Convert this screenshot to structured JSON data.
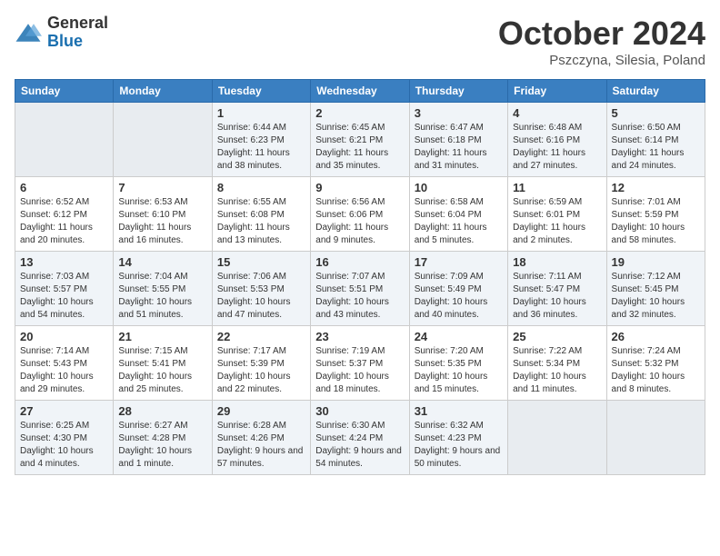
{
  "logo": {
    "general": "General",
    "blue": "Blue"
  },
  "title": "October 2024",
  "location": "Pszczyna, Silesia, Poland",
  "days_of_week": [
    "Sunday",
    "Monday",
    "Tuesday",
    "Wednesday",
    "Thursday",
    "Friday",
    "Saturday"
  ],
  "weeks": [
    [
      {
        "day": "",
        "sunrise": "",
        "sunset": "",
        "daylight": "",
        "empty": true
      },
      {
        "day": "",
        "sunrise": "",
        "sunset": "",
        "daylight": "",
        "empty": true
      },
      {
        "day": "1",
        "sunrise": "Sunrise: 6:44 AM",
        "sunset": "Sunset: 6:23 PM",
        "daylight": "Daylight: 11 hours and 38 minutes."
      },
      {
        "day": "2",
        "sunrise": "Sunrise: 6:45 AM",
        "sunset": "Sunset: 6:21 PM",
        "daylight": "Daylight: 11 hours and 35 minutes."
      },
      {
        "day": "3",
        "sunrise": "Sunrise: 6:47 AM",
        "sunset": "Sunset: 6:18 PM",
        "daylight": "Daylight: 11 hours and 31 minutes."
      },
      {
        "day": "4",
        "sunrise": "Sunrise: 6:48 AM",
        "sunset": "Sunset: 6:16 PM",
        "daylight": "Daylight: 11 hours and 27 minutes."
      },
      {
        "day": "5",
        "sunrise": "Sunrise: 6:50 AM",
        "sunset": "Sunset: 6:14 PM",
        "daylight": "Daylight: 11 hours and 24 minutes."
      }
    ],
    [
      {
        "day": "6",
        "sunrise": "Sunrise: 6:52 AM",
        "sunset": "Sunset: 6:12 PM",
        "daylight": "Daylight: 11 hours and 20 minutes."
      },
      {
        "day": "7",
        "sunrise": "Sunrise: 6:53 AM",
        "sunset": "Sunset: 6:10 PM",
        "daylight": "Daylight: 11 hours and 16 minutes."
      },
      {
        "day": "8",
        "sunrise": "Sunrise: 6:55 AM",
        "sunset": "Sunset: 6:08 PM",
        "daylight": "Daylight: 11 hours and 13 minutes."
      },
      {
        "day": "9",
        "sunrise": "Sunrise: 6:56 AM",
        "sunset": "Sunset: 6:06 PM",
        "daylight": "Daylight: 11 hours and 9 minutes."
      },
      {
        "day": "10",
        "sunrise": "Sunrise: 6:58 AM",
        "sunset": "Sunset: 6:04 PM",
        "daylight": "Daylight: 11 hours and 5 minutes."
      },
      {
        "day": "11",
        "sunrise": "Sunrise: 6:59 AM",
        "sunset": "Sunset: 6:01 PM",
        "daylight": "Daylight: 11 hours and 2 minutes."
      },
      {
        "day": "12",
        "sunrise": "Sunrise: 7:01 AM",
        "sunset": "Sunset: 5:59 PM",
        "daylight": "Daylight: 10 hours and 58 minutes."
      }
    ],
    [
      {
        "day": "13",
        "sunrise": "Sunrise: 7:03 AM",
        "sunset": "Sunset: 5:57 PM",
        "daylight": "Daylight: 10 hours and 54 minutes."
      },
      {
        "day": "14",
        "sunrise": "Sunrise: 7:04 AM",
        "sunset": "Sunset: 5:55 PM",
        "daylight": "Daylight: 10 hours and 51 minutes."
      },
      {
        "day": "15",
        "sunrise": "Sunrise: 7:06 AM",
        "sunset": "Sunset: 5:53 PM",
        "daylight": "Daylight: 10 hours and 47 minutes."
      },
      {
        "day": "16",
        "sunrise": "Sunrise: 7:07 AM",
        "sunset": "Sunset: 5:51 PM",
        "daylight": "Daylight: 10 hours and 43 minutes."
      },
      {
        "day": "17",
        "sunrise": "Sunrise: 7:09 AM",
        "sunset": "Sunset: 5:49 PM",
        "daylight": "Daylight: 10 hours and 40 minutes."
      },
      {
        "day": "18",
        "sunrise": "Sunrise: 7:11 AM",
        "sunset": "Sunset: 5:47 PM",
        "daylight": "Daylight: 10 hours and 36 minutes."
      },
      {
        "day": "19",
        "sunrise": "Sunrise: 7:12 AM",
        "sunset": "Sunset: 5:45 PM",
        "daylight": "Daylight: 10 hours and 32 minutes."
      }
    ],
    [
      {
        "day": "20",
        "sunrise": "Sunrise: 7:14 AM",
        "sunset": "Sunset: 5:43 PM",
        "daylight": "Daylight: 10 hours and 29 minutes."
      },
      {
        "day": "21",
        "sunrise": "Sunrise: 7:15 AM",
        "sunset": "Sunset: 5:41 PM",
        "daylight": "Daylight: 10 hours and 25 minutes."
      },
      {
        "day": "22",
        "sunrise": "Sunrise: 7:17 AM",
        "sunset": "Sunset: 5:39 PM",
        "daylight": "Daylight: 10 hours and 22 minutes."
      },
      {
        "day": "23",
        "sunrise": "Sunrise: 7:19 AM",
        "sunset": "Sunset: 5:37 PM",
        "daylight": "Daylight: 10 hours and 18 minutes."
      },
      {
        "day": "24",
        "sunrise": "Sunrise: 7:20 AM",
        "sunset": "Sunset: 5:35 PM",
        "daylight": "Daylight: 10 hours and 15 minutes."
      },
      {
        "day": "25",
        "sunrise": "Sunrise: 7:22 AM",
        "sunset": "Sunset: 5:34 PM",
        "daylight": "Daylight: 10 hours and 11 minutes."
      },
      {
        "day": "26",
        "sunrise": "Sunrise: 7:24 AM",
        "sunset": "Sunset: 5:32 PM",
        "daylight": "Daylight: 10 hours and 8 minutes."
      }
    ],
    [
      {
        "day": "27",
        "sunrise": "Sunrise: 6:25 AM",
        "sunset": "Sunset: 4:30 PM",
        "daylight": "Daylight: 10 hours and 4 minutes."
      },
      {
        "day": "28",
        "sunrise": "Sunrise: 6:27 AM",
        "sunset": "Sunset: 4:28 PM",
        "daylight": "Daylight: 10 hours and 1 minute."
      },
      {
        "day": "29",
        "sunrise": "Sunrise: 6:28 AM",
        "sunset": "Sunset: 4:26 PM",
        "daylight": "Daylight: 9 hours and 57 minutes."
      },
      {
        "day": "30",
        "sunrise": "Sunrise: 6:30 AM",
        "sunset": "Sunset: 4:24 PM",
        "daylight": "Daylight: 9 hours and 54 minutes."
      },
      {
        "day": "31",
        "sunrise": "Sunrise: 6:32 AM",
        "sunset": "Sunset: 4:23 PM",
        "daylight": "Daylight: 9 hours and 50 minutes."
      },
      {
        "day": "",
        "sunrise": "",
        "sunset": "",
        "daylight": "",
        "empty": true
      },
      {
        "day": "",
        "sunrise": "",
        "sunset": "",
        "daylight": "",
        "empty": true
      }
    ]
  ]
}
